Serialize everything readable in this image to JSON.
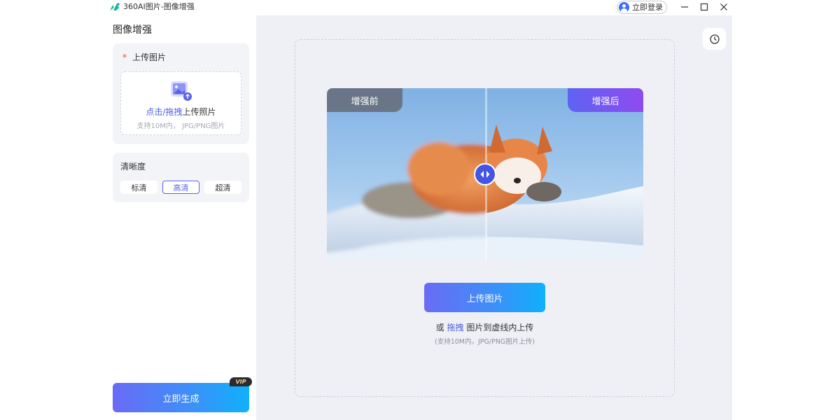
{
  "window": {
    "title": "360AI图片-图像增强",
    "login_label": "立即登录"
  },
  "sidebar": {
    "title": "图像增强",
    "upload": {
      "required_mark": "*",
      "label": "上传图片",
      "action_prefix": "点击/拖拽",
      "action_suffix": "上传照片",
      "hint": "支持10M内， JPG/PNG图片"
    },
    "clarity": {
      "label": "清晰度",
      "options": [
        "标清",
        "高清",
        "超清"
      ],
      "selected": "高清"
    },
    "vip_badge": "VIP",
    "generate_label": "立即生成"
  },
  "main": {
    "preview": {
      "before_label": "增强前",
      "after_label": "增强后"
    },
    "upload_button": "上传图片",
    "drop_prefix": "或",
    "drop_link": "拖拽",
    "drop_suffix": "图片到虚线内上传",
    "drop_hint": "(支持10M内，JPG/PNG图片上传)"
  },
  "colors": {
    "accent": "#5c63ea",
    "button_gradient_start": "#6a6bf5",
    "button_gradient_end": "#0fb1fb",
    "required": "#e84545",
    "main_background": "#eef0f5"
  },
  "icons": [
    "app-logo",
    "user-avatar-icon",
    "minimize-icon",
    "maximize-icon",
    "close-icon",
    "image-upload-icon",
    "history-clock-icon",
    "split-handle-arrows-icon"
  ]
}
